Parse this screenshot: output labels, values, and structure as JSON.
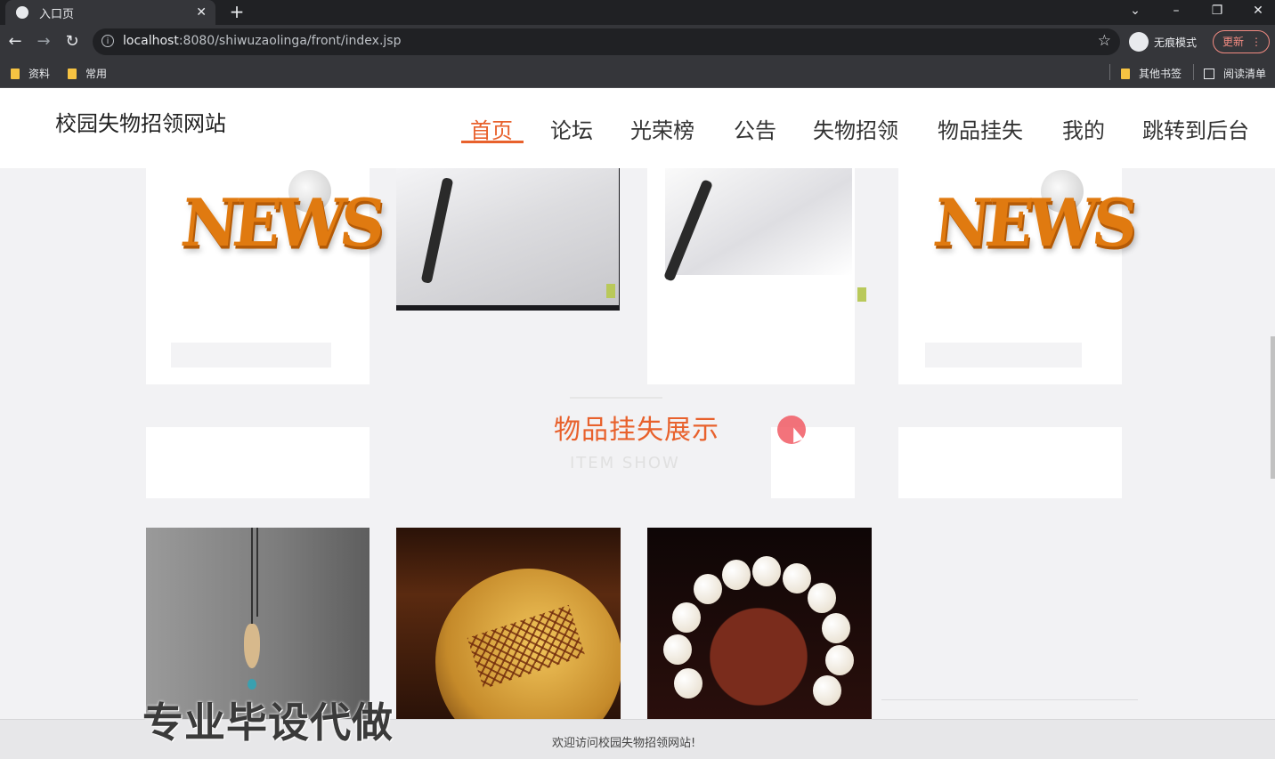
{
  "browser": {
    "tab_title": "入口页",
    "tab_close": "✕",
    "new_tab": "+",
    "url_host": "localhost",
    "url_path": ":8080/shiwuzaolinga/front/index.jsp",
    "incognito_label": "无痕模式",
    "update_label": "更新",
    "bookmarks": [
      "资料",
      "常用"
    ],
    "bookmarks_right": [
      "其他书签",
      "阅读清单"
    ]
  },
  "site": {
    "title": "校园失物招领网站",
    "nav": [
      "首页",
      "论坛",
      "光荣榜",
      "公告",
      "失物招领",
      "物品挂失",
      "我的",
      "跳转到后台"
    ],
    "active_nav_index": 0
  },
  "news_cards": {
    "news_word": "NEWS"
  },
  "section": {
    "title": "物品挂失展示",
    "subtitle": "ITEM SHOW"
  },
  "watermark": "专业毕设代做",
  "footer": {
    "text": "欢迎访问校园失物招领网站!"
  },
  "colors": {
    "accent": "#e8612c",
    "news_orange": "#e07a10"
  }
}
